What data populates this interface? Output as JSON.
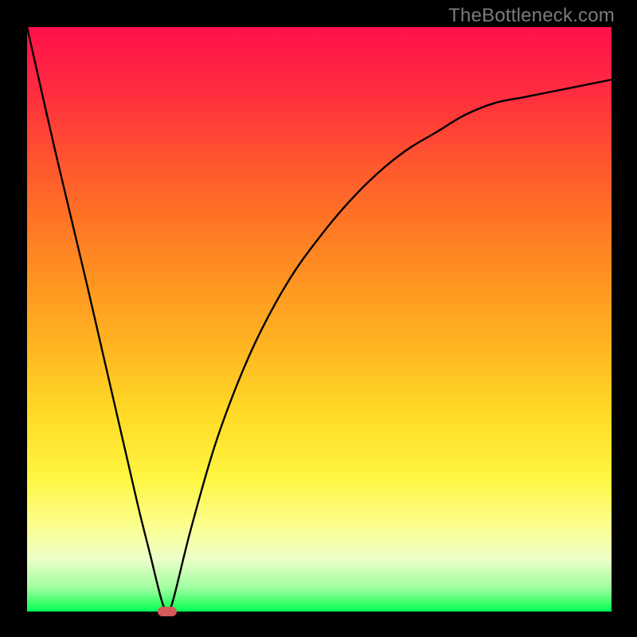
{
  "watermark": "TheBottleneck.com",
  "chart_data": {
    "type": "line",
    "title": "",
    "xlabel": "",
    "ylabel": "",
    "xlim": [
      0,
      100
    ],
    "ylim": [
      0,
      100
    ],
    "grid": false,
    "series": [
      {
        "name": "bottleneck-curve",
        "x": [
          0,
          5,
          10,
          13,
          16,
          19,
          21,
          23,
          24,
          25,
          28,
          32,
          36,
          40,
          45,
          50,
          55,
          60,
          65,
          70,
          75,
          80,
          85,
          90,
          95,
          100
        ],
        "values": [
          100,
          78,
          57,
          44,
          31,
          18,
          10,
          2,
          0,
          2,
          14,
          28,
          39,
          48,
          57,
          64,
          70,
          75,
          79,
          82,
          85,
          87,
          88,
          89,
          90,
          91
        ]
      }
    ],
    "minimum_point": {
      "x": 24,
      "y": 0
    },
    "marker": {
      "shape": "rounded-rect",
      "color": "#d65a5a"
    }
  },
  "colors": {
    "background": "#000000",
    "gradient_top": "#ff114c",
    "gradient_bottom": "#00ff5a",
    "curve": "#000000"
  }
}
